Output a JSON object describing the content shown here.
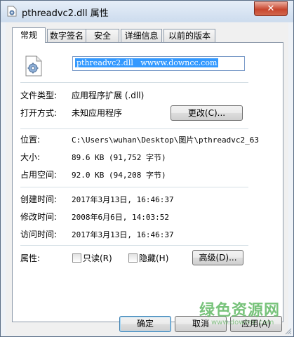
{
  "window": {
    "title": "pthreadvc2.dll 属性",
    "close_label": "✕"
  },
  "tabs": [
    {
      "label": "常规",
      "active": true
    },
    {
      "label": "数字签名",
      "active": false
    },
    {
      "label": "安全",
      "active": false
    },
    {
      "label": "详细信息",
      "active": false
    },
    {
      "label": "以前的版本",
      "active": false
    }
  ],
  "general": {
    "file_name": "pthreadvc2.dll   wwww.downcc.com",
    "file_type_label": "文件类型:",
    "file_type_value": "应用程序扩展 (.dll)",
    "open_with_label": "打开方式:",
    "open_with_value": "未知应用程序",
    "change_button": "更改(C)...",
    "location_label": "位置:",
    "location_value": "C:\\Users\\wuhan\\Desktop\\图片\\pthreadvc2_63",
    "size_label": "大小:",
    "size_value": "89.6 KB (91,752 字节)",
    "size_on_disk_label": "占用空间:",
    "size_on_disk_value": "92.0 KB (94,208 字节)",
    "created_label": "创建时间:",
    "created_value": "2017年3月13日, 16:46:37",
    "modified_label": "修改时间:",
    "modified_value": "2008年6月6日, 14:03:52",
    "accessed_label": "访问时间:",
    "accessed_value": "2017年3月13日, 16:46:37",
    "attributes_label": "属性:",
    "readonly_label": "只读(R)",
    "hidden_label": "隐藏(H)",
    "advanced_button": "高级(D)..."
  },
  "buttons": {
    "ok": "确定",
    "cancel": "取消",
    "apply": "应用(A)"
  },
  "watermark": {
    "text": "绿色资源网",
    "url": "www.downcc.com"
  },
  "colors": {
    "selection": "#3399ff",
    "close_button": "#c8472f",
    "watermark": "#4caf50"
  }
}
